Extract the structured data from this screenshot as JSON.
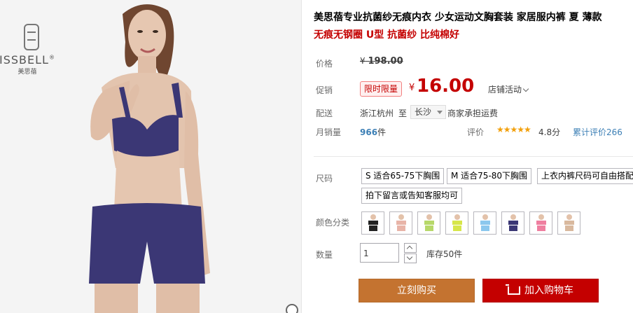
{
  "gallery": {
    "brand_text": "ISSBELL",
    "brand_registered": "®",
    "brand_sub": "美思蓓",
    "main_color": "#3b3775"
  },
  "product": {
    "title": "美思蓓专业抗菌纱无痕内衣 少女运动文胸套装 家居服内裤 夏 薄款",
    "subtitle": "无痕无钢圈 U型 抗菌纱 比纯棉好"
  },
  "price": {
    "label": "价格",
    "currency": "¥",
    "original": "198.00"
  },
  "promo": {
    "label": "促销",
    "tag": "限时限量",
    "currency": "¥",
    "price": "16.00",
    "shop_activity": "店铺活动"
  },
  "shipping": {
    "label": "配送",
    "from": "浙江杭州",
    "to_word": "至",
    "city": "长沙",
    "fee": "商家承担运费"
  },
  "sales": {
    "label": "月销量",
    "count": "966",
    "unit": "件",
    "review_label": "评价",
    "stars": "★★★★★",
    "rating": 4.8,
    "score_text": "4.8分",
    "review_text": "累计评价266"
  },
  "sizes": {
    "label": "尺码",
    "options": [
      "S 适合65-75下胸围",
      "M 适合75-80下胸围",
      "上衣内裤尺码可自由搭配",
      "拍下留言或告知客服均可"
    ]
  },
  "colors": {
    "label": "颜色分类",
    "swatches": [
      {
        "top": "#222222",
        "bottom": "#222222"
      },
      {
        "top": "#e8b4a8",
        "bottom": "#e8b4a8"
      },
      {
        "top": "#b7d86a",
        "bottom": "#b7d86a"
      },
      {
        "top": "#d7e64a",
        "bottom": "#d7e64a"
      },
      {
        "top": "#8cc8ee",
        "bottom": "#8cc8ee"
      },
      {
        "top": "#3b3775",
        "bottom": "#3b3775"
      },
      {
        "top": "#ef7fa0",
        "bottom": "#ef7fa0"
      },
      {
        "top": "#d9b99e",
        "bottom": "#d9b99e"
      }
    ]
  },
  "quantity": {
    "label": "数量",
    "value": "1",
    "stock": "库存50件"
  },
  "actions": {
    "buy_now": "立刻购买",
    "add_cart": "加入购物车"
  }
}
